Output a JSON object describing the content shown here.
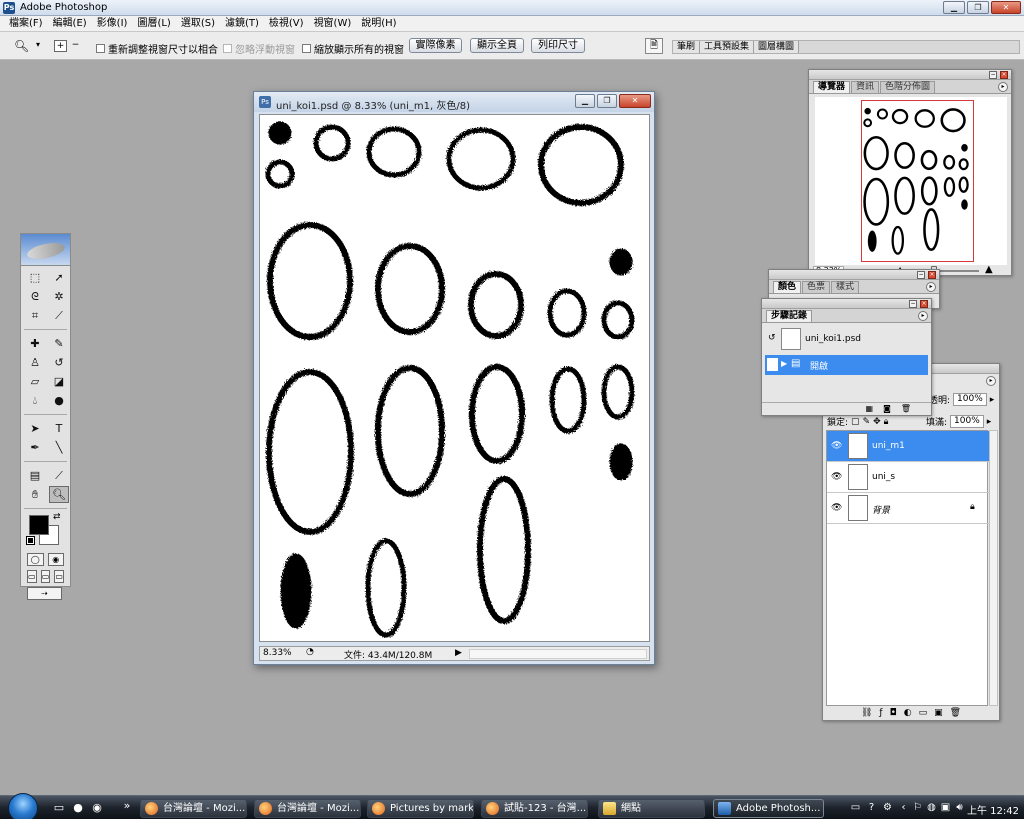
{
  "app": {
    "title": "Adobe Photoshop"
  },
  "menu": [
    "檔案(F)",
    "編輯(E)",
    "影像(I)",
    "圖層(L)",
    "選取(S)",
    "濾鏡(T)",
    "檢視(V)",
    "視窗(W)",
    "說明(H)"
  ],
  "options": {
    "chk_resize": "重新調整視窗尺寸以相合",
    "chk_ignore": "忽略浮動視窗",
    "chk_zoom_all": "縮放顯示所有的視窗",
    "btn_actual": "實際像素",
    "btn_fit": "顯示全頁",
    "btn_print": "列印尺寸",
    "well_tabs": [
      "筆刷",
      "工具預設集",
      "圖層構圖"
    ]
  },
  "document": {
    "title": "uni_koi1.psd @ 8.33% (uni_m1, 灰色/8)",
    "zoom": "8.33%",
    "file_info": "文件: 43.4M/120.8M"
  },
  "navigator": {
    "tabs": [
      "導覽器",
      "資訊",
      "色階分佈圖"
    ],
    "zoom": "8.33%",
    "zoom_percent": 50
  },
  "color_palette": {
    "tabs": [
      "顏色",
      "色票",
      "樣式"
    ]
  },
  "history": {
    "tab": "步驟記錄",
    "snapshot": "uni_koi1.psd",
    "state": "開啟"
  },
  "layers": {
    "opacity_label": "透明:",
    "opacity": "100%",
    "lock_label": "鎖定:",
    "fill_label": "填滿:",
    "fill": "100%",
    "items": [
      {
        "name": "uni_m1",
        "selected": true
      },
      {
        "name": "uni_s",
        "selected": false
      },
      {
        "name": "背景",
        "selected": false,
        "locked": true
      }
    ]
  },
  "taskbar": {
    "buttons": [
      "台灣論壇 - Mozi...",
      "台灣論壇 - Mozi...",
      "Pictures by mark...",
      "試貼-123 - 台灣...",
      "網點",
      "Adobe Photosh..."
    ],
    "clock": "上午 12:42"
  },
  "colors": {
    "selection": "#3c8cf0",
    "workspace": "#a8a8a8",
    "nav_frame": "#d43a3a"
  },
  "icons": [
    "zoom-tool-icon",
    "move-icon",
    "marquee-icon",
    "lasso-icon",
    "magic-wand-icon",
    "crop-icon",
    "slice-icon",
    "healing-icon",
    "brush-icon",
    "stamp-icon",
    "history-brush-icon",
    "eraser-icon",
    "bucket-icon",
    "blur-icon",
    "dodge-icon",
    "path-select-icon",
    "type-icon",
    "pen-icon",
    "line-icon",
    "notes-icon",
    "eyedropper-icon",
    "hand-icon",
    "eye-icon",
    "lock-icon",
    "trash-icon"
  ]
}
